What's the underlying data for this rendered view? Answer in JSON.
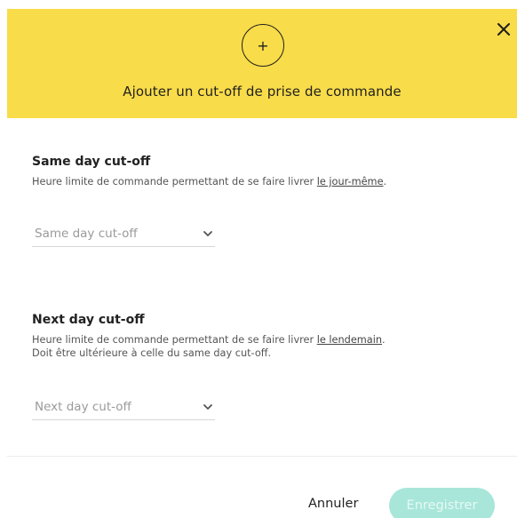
{
  "header": {
    "add_icon_glyph": "+",
    "title": "Ajouter un cut-off de prise de commande",
    "close_glyph": "✕",
    "background": "#f9dc49"
  },
  "same_day": {
    "title": "Same day cut-off",
    "description_prefix": "Heure limite de commande permettant de se faire livrer ",
    "description_link": "le jour-même",
    "description_suffix": ".",
    "select_placeholder": "Same day cut-off"
  },
  "next_day": {
    "title": "Next day cut-off",
    "description_prefix": "Heure limite de commande permettant de se faire livrer ",
    "description_link": "le lendemain",
    "description_suffix": ".",
    "description_line2": "Doit être ultérieure à celle du same day cut-off.",
    "select_placeholder": "Next day cut-off"
  },
  "footer": {
    "cancel_label": "Annuler",
    "save_label": "Enregistrer",
    "save_color": "#a8e6da"
  }
}
